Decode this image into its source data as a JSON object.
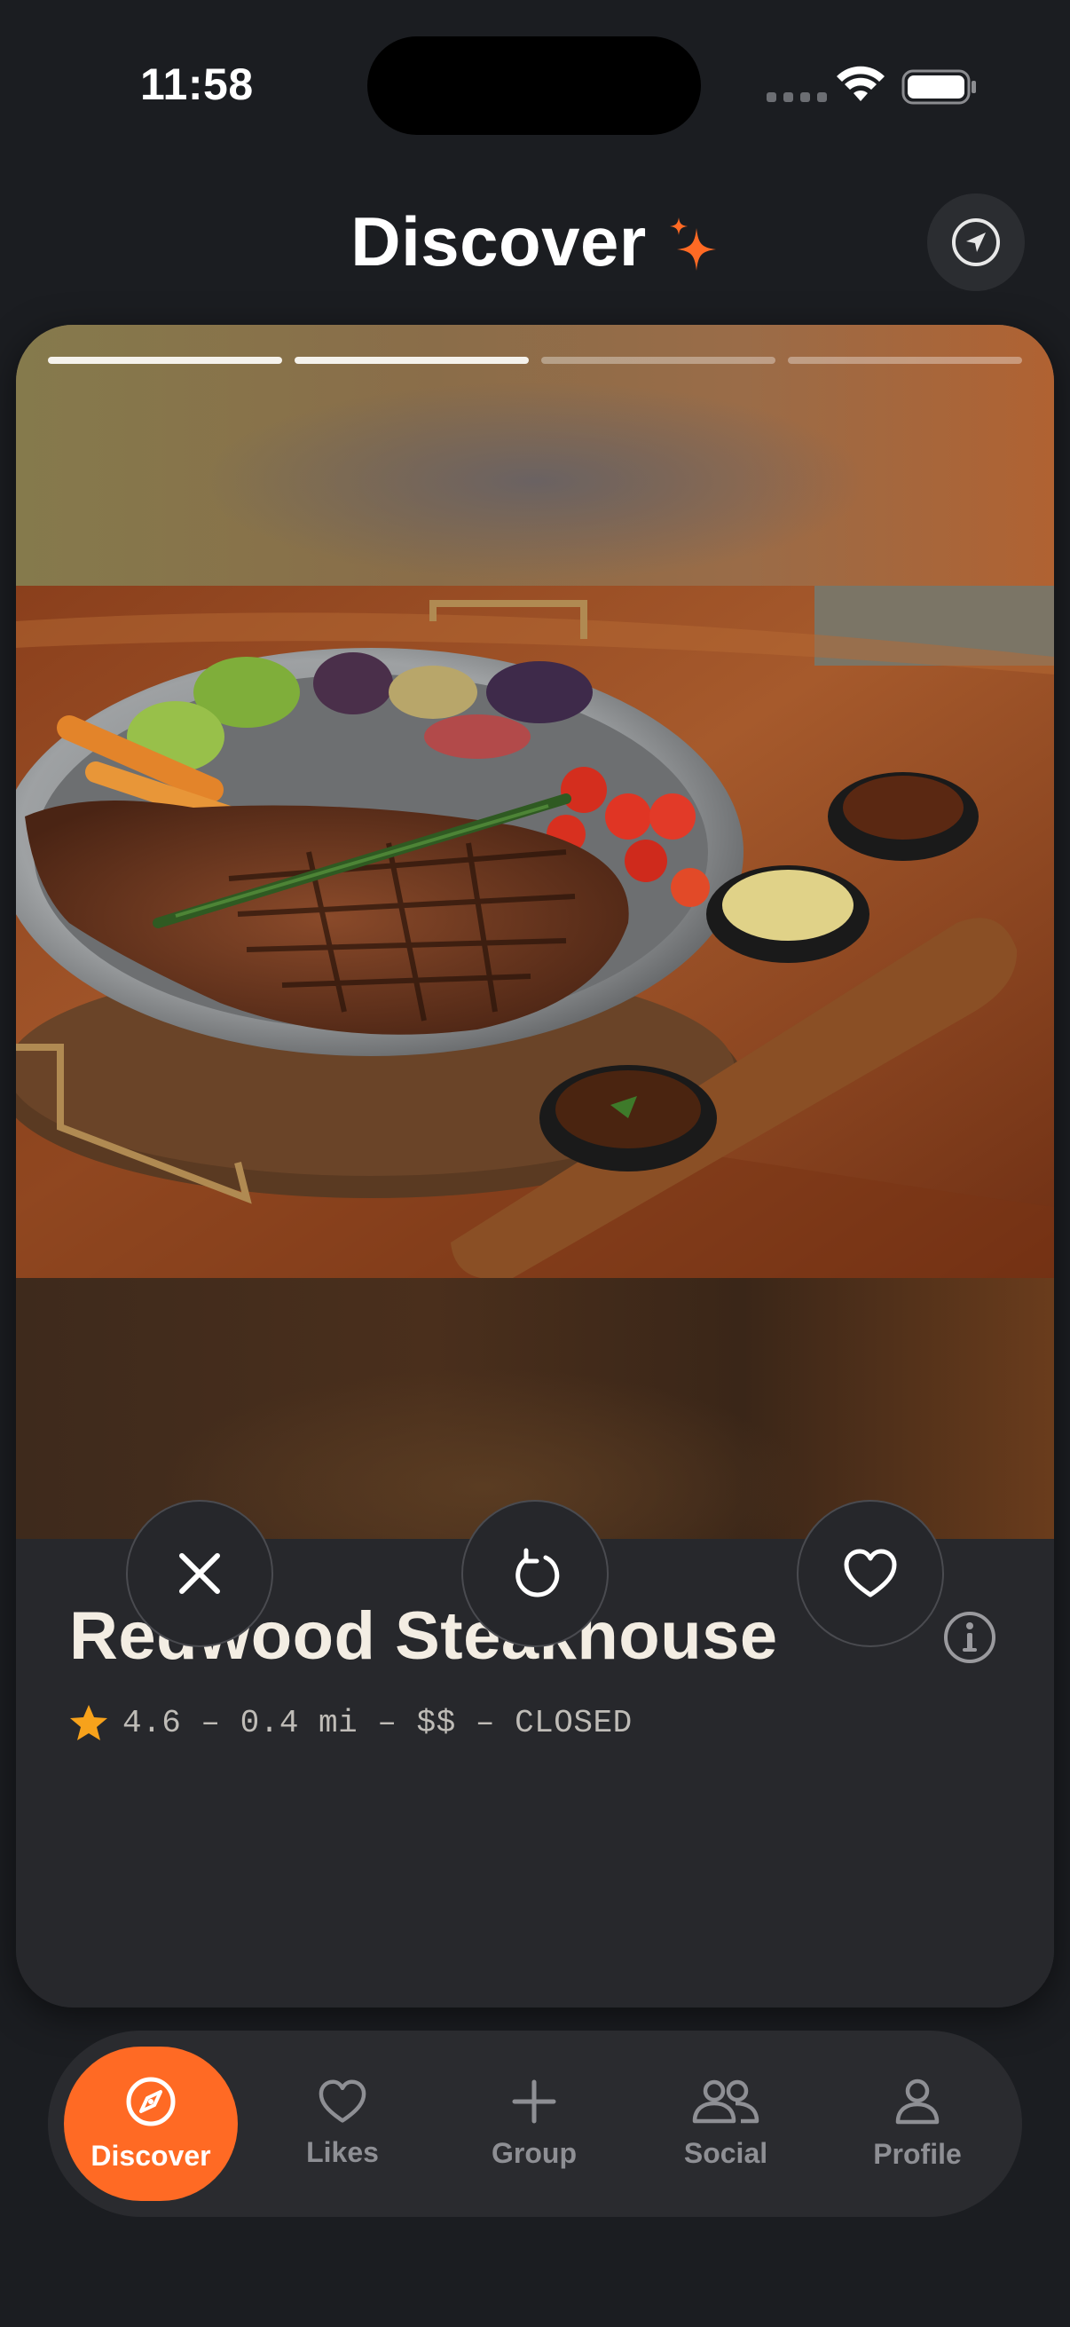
{
  "status_bar": {
    "time": "11:58"
  },
  "header": {
    "title": "Discover"
  },
  "card": {
    "photo_count": 4,
    "current_photo": 2,
    "restaurant": {
      "name": "Redwood Steakhouse",
      "rating": "4.6",
      "meta_line": "4.6 – 0.4 mi – $$ – CLOSED",
      "distance": "0.4 mi",
      "price": "$$",
      "status": "CLOSED"
    },
    "actions": [
      "close-icon",
      "undo-icon",
      "heart-icon"
    ]
  },
  "tabs": [
    {
      "label": "Discover",
      "icon": "compass-icon",
      "active": true
    },
    {
      "label": "Likes",
      "icon": "heart-icon",
      "active": false
    },
    {
      "label": "Group",
      "icon": "plus-icon",
      "active": false
    },
    {
      "label": "Social",
      "icon": "people-icon",
      "active": false
    },
    {
      "label": "Profile",
      "icon": "person-icon",
      "active": false
    }
  ],
  "colors": {
    "accent": "#ff6a24",
    "background": "#1b1d21",
    "card": "#27282c",
    "star": "#f7a21b"
  }
}
